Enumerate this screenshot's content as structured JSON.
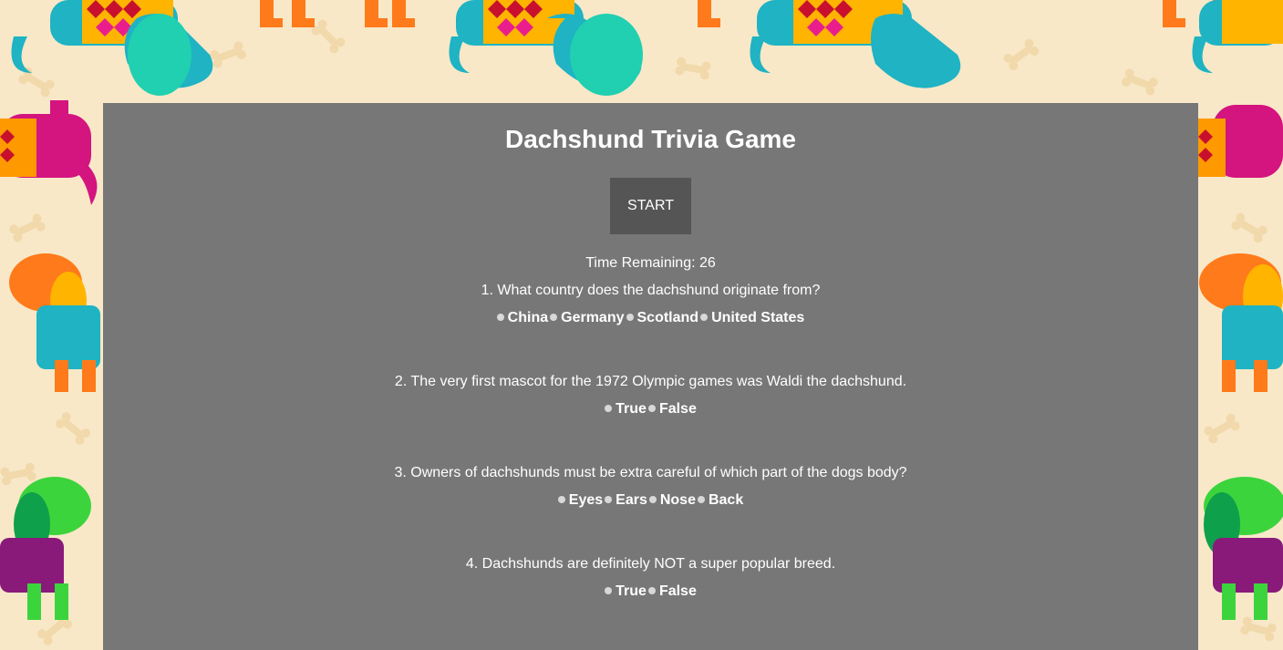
{
  "game": {
    "title": "Dachshund Trivia Game",
    "start_label": "START",
    "timer_label": "Time Remaining: ",
    "timer_value": "26"
  },
  "questions": [
    {
      "text": "1. What country does the dachshund originate from?",
      "answers": [
        "China",
        "Germany",
        "Scotland",
        "United States"
      ]
    },
    {
      "text": "2. The very first mascot for the 1972 Olympic games was Waldi the dachshund.",
      "answers": [
        "True",
        "False"
      ]
    },
    {
      "text": "3. Owners of dachshunds must be extra careful of which part of the dogs body?",
      "answers": [
        "Eyes",
        "Ears",
        "Nose",
        "Back"
      ]
    },
    {
      "text": "4. Dachshunds are definitely NOT a super popular breed.",
      "answers": [
        "True",
        "False"
      ]
    }
  ],
  "colors": {
    "background": "#f8e8c8",
    "panel": "#777777",
    "button": "#555555",
    "text": "#ffffff"
  },
  "background_pattern": {
    "icons": [
      "dachshund-icon",
      "bone-icon"
    ]
  }
}
